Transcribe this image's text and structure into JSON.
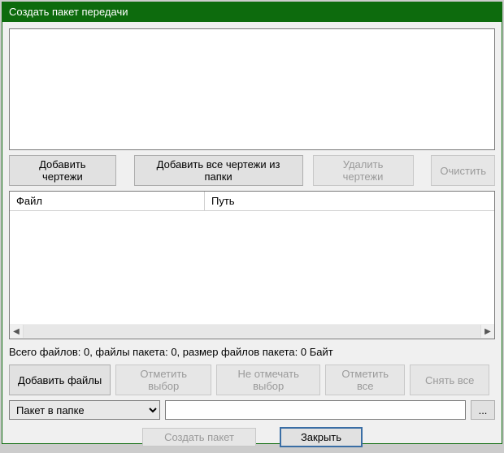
{
  "titlebar": {
    "title": "Создать пакет передачи"
  },
  "toolbar1": {
    "add_drawings": "Добавить чертежи",
    "add_all_from_folder": "Добавить все чертежи из папки",
    "delete_drawings": "Удалить чертежи",
    "clear": "Очистить"
  },
  "table": {
    "col_file": "Файл",
    "col_path": "Путь"
  },
  "status": {
    "text": "Всего файлов: 0, файлы пакета: 0, размер файлов пакета: 0 Байт"
  },
  "toolbar2": {
    "add_files": "Добавить файлы",
    "mark_selection": "Отметить выбор",
    "unmark_selection": "Не отмечать выбор",
    "mark_all": "Отметить все",
    "uncheck_all": "Снять все"
  },
  "dest": {
    "mode_selected": "Пакет в папке",
    "path_value": "",
    "browse_label": "..."
  },
  "footer": {
    "create_package": "Создать пакет",
    "close": "Закрыть"
  }
}
